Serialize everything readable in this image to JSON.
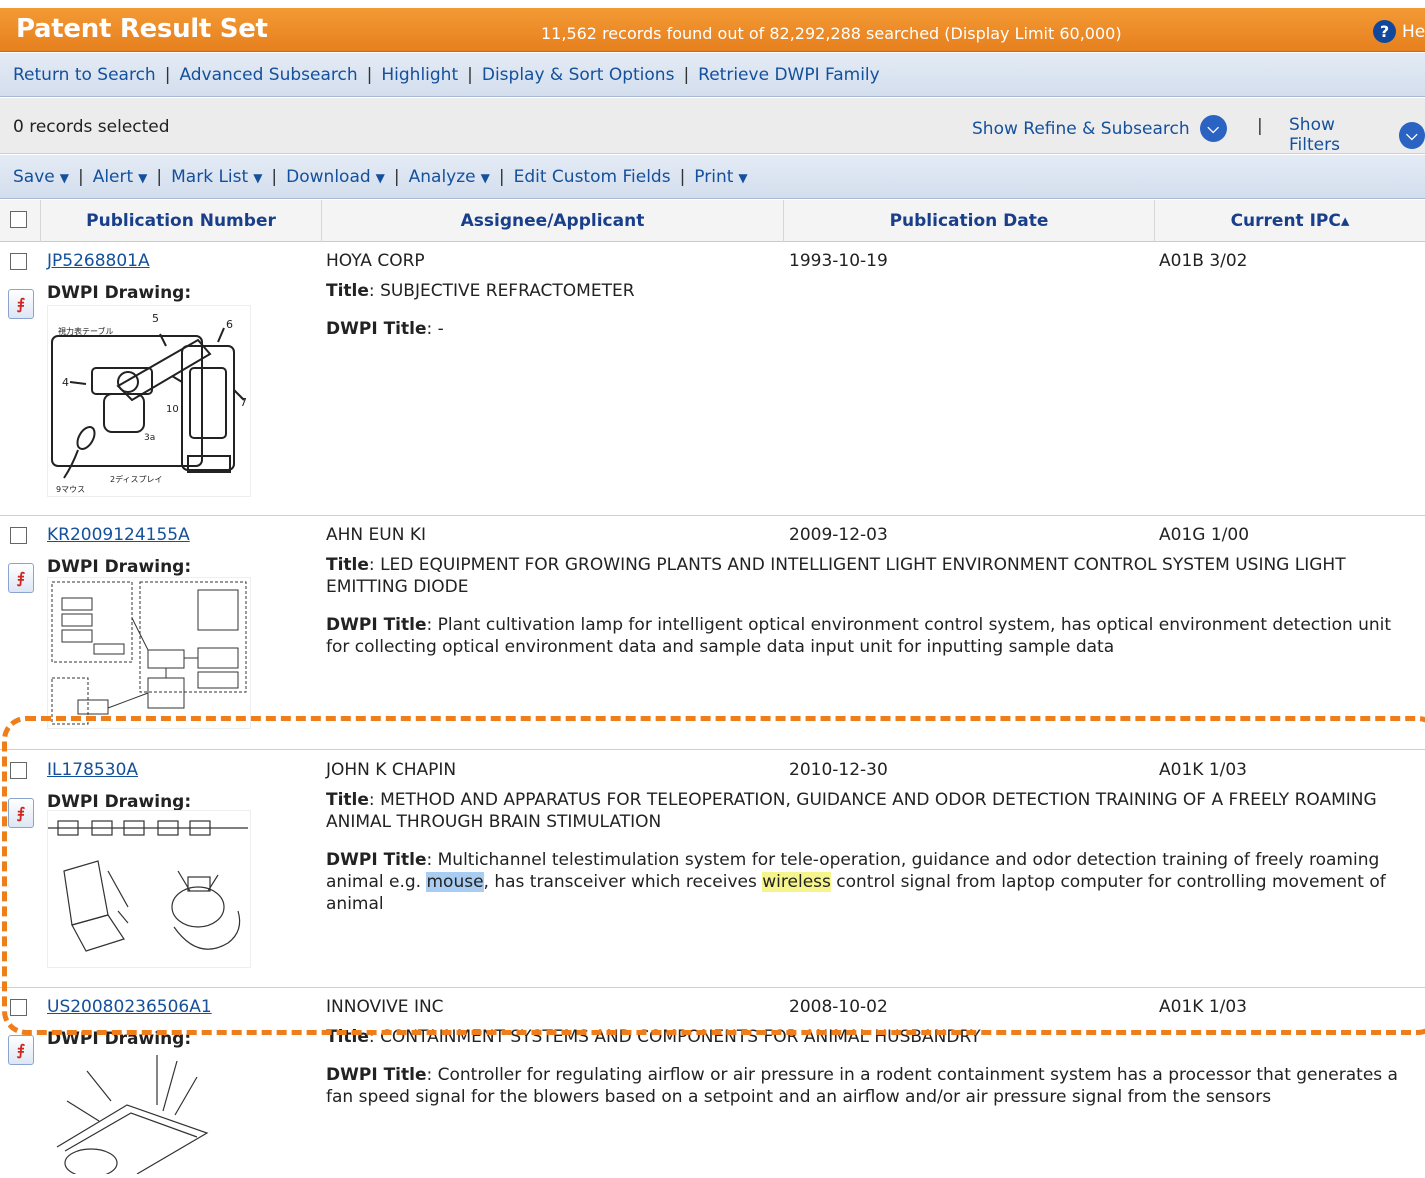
{
  "header": {
    "title": "Patent Result Set",
    "records_info": "11,562 records found out of 82,292,288 searched (Display Limit 60,000)",
    "help_label": "He"
  },
  "nav": {
    "return_to_search": "Return to Search",
    "advanced_subsearch": "Advanced Subsearch",
    "highlight": "Highlight",
    "display_sort": "Display & Sort Options",
    "retrieve_family": "Retrieve DWPI Family"
  },
  "selection": {
    "count_text": "0 records selected",
    "show_refine": "Show Refine & Subsearch",
    "show_filters": "Show Filters"
  },
  "actions": {
    "save": "Save",
    "alert": "Alert",
    "mark_list": "Mark List",
    "download": "Download",
    "analyze": "Analyze",
    "edit_custom": "Edit Custom Fields",
    "print": "Print"
  },
  "table": {
    "col_pub": "Publication Number",
    "col_assignee": "Assignee/Applicant",
    "col_date": "Publication Date",
    "col_ipc": "Current IPC▴"
  },
  "labels": {
    "drawing": "DWPI Drawing:",
    "title": "Title",
    "dwpi_title": "DWPI Title"
  },
  "rows": [
    {
      "pub": "JP5268801A",
      "assignee": "HOYA CORP",
      "date": "1993-10-19",
      "ipc": "A01B 3/02",
      "title": "SUBJECTIVE REFRACTOMETER",
      "dwpi_title": "-"
    },
    {
      "pub": "KR2009124155A",
      "assignee": "AHN EUN KI",
      "date": "2009-12-03",
      "ipc": "A01G 1/00",
      "title": "LED EQUIPMENT FOR GROWING PLANTS AND INTELLIGENT LIGHT ENVIRONMENT CONTROL SYSTEM USING LIGHT EMITTING DIODE",
      "dwpi_title": "Plant cultivation lamp for intelligent optical environment control system, has optical environment detection unit for collecting optical environment data and sample data input unit for inputting sample data"
    },
    {
      "pub": "IL178530A",
      "assignee": "JOHN K CHAPIN",
      "date": "2010-12-30",
      "ipc": "A01K 1/03",
      "title": "METHOD AND APPARATUS FOR TELEOPERATION, GUIDANCE AND ODOR DETECTION TRAINING OF A FREELY ROAMING ANIMAL THROUGH BRAIN STIMULATION",
      "dwpi_part1": "Multichannel telestimulation system for tele-operation, guidance and odor detection training of freely roaming animal e.g. ",
      "dwpi_hl1": "mouse",
      "dwpi_part2": ", has transceiver which receives ",
      "dwpi_hl2": "wireless",
      "dwpi_part3": " control signal from laptop computer for controlling movement of animal"
    },
    {
      "pub": "US20080236506A1",
      "assignee": "INNOVIVE INC",
      "date": "2008-10-02",
      "ipc": "A01K 1/03",
      "title": "CONTAINMENT SYSTEMS AND COMPONENTS FOR ANIMAL HUSBANDRY",
      "dwpi_title": "Controller for regulating airflow or air pressure in a rodent containment system has a processor that generates a fan speed signal for the blowers based on a setpoint and an airflow and/or air pressure signal from the sensors"
    }
  ],
  "drawing_text": {
    "d1_table": "視力表テーブル",
    "d1_display": "2ディスプレイ",
    "d1_mouse": "9マウス",
    "d1_n5": "5",
    "d1_n6": "6",
    "d1_n4": "4",
    "d1_n10": "10",
    "d1_n7": "7",
    "d1_n3": "3a"
  },
  "colors": {
    "header_orange": "#ef8a24",
    "link_blue": "#14509b",
    "highlight_box": "#ef7d1a",
    "hl_mouse": "#a9ccf2",
    "hl_wireless": "#f6f48c"
  }
}
